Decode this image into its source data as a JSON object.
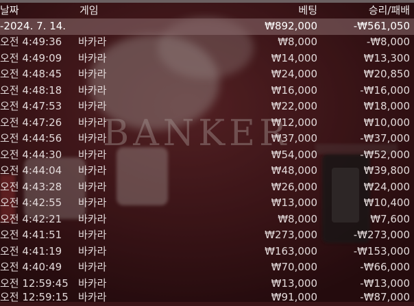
{
  "header": {
    "date": "날짜",
    "game": "게임",
    "bet": "베팅",
    "winloss": "승리/패배"
  },
  "summary": {
    "date": "-2024. 7. 14.",
    "bet": "₩892,000",
    "winloss": "-₩561,050"
  },
  "rows": [
    {
      "time": "오전 4:49:36",
      "game": "바카라",
      "bet": "₩8,000",
      "winloss": "-₩8,000"
    },
    {
      "time": "오전 4:49:09",
      "game": "바카라",
      "bet": "₩14,000",
      "winloss": "₩13,300"
    },
    {
      "time": "오전 4:48:45",
      "game": "바카라",
      "bet": "₩24,000",
      "winloss": "₩20,850"
    },
    {
      "time": "오전 4:48:18",
      "game": "바카라",
      "bet": "₩16,000",
      "winloss": "-₩16,000"
    },
    {
      "time": "오전 4:47:53",
      "game": "바카라",
      "bet": "₩22,000",
      "winloss": "₩18,000"
    },
    {
      "time": "오전 4:47:26",
      "game": "바카라",
      "bet": "₩12,000",
      "winloss": "₩10,000"
    },
    {
      "time": "오전 4:44:56",
      "game": "바카라",
      "bet": "₩37,000",
      "winloss": "-₩37,000"
    },
    {
      "time": "오전 4:44:30",
      "game": "바카라",
      "bet": "₩54,000",
      "winloss": "-₩52,000"
    },
    {
      "time": "오전 4:44:04",
      "game": "바카라",
      "bet": "₩48,000",
      "winloss": "₩39,800"
    },
    {
      "time": "오전 4:43:28",
      "game": "바카라",
      "bet": "₩26,000",
      "winloss": "₩24,000"
    },
    {
      "time": "오전 4:42:55",
      "game": "바카라",
      "bet": "₩13,000",
      "winloss": "₩10,400"
    },
    {
      "time": "오전 4:42:21",
      "game": "바카라",
      "bet": "₩8,000",
      "winloss": "₩7,600"
    },
    {
      "time": "오전 4:41:51",
      "game": "바카라",
      "bet": "₩273,000",
      "winloss": "-₩273,000"
    },
    {
      "time": "오전 4:41:19",
      "game": "바카라",
      "bet": "₩163,000",
      "winloss": "-₩153,000"
    },
    {
      "time": "오전 4:40:49",
      "game": "바카라",
      "bet": "₩70,000",
      "winloss": "-₩66,000"
    },
    {
      "time": "오전 12:59:45",
      "game": "바카라",
      "bet": "₩13,000",
      "winloss": "-₩13,000"
    },
    {
      "time": "오전 12:59:15",
      "game": "바카라",
      "bet": "₩91,000",
      "winloss": "-₩87,000"
    }
  ],
  "background": {
    "table_text": "BANKER",
    "table_color": "#4a1a1e"
  }
}
